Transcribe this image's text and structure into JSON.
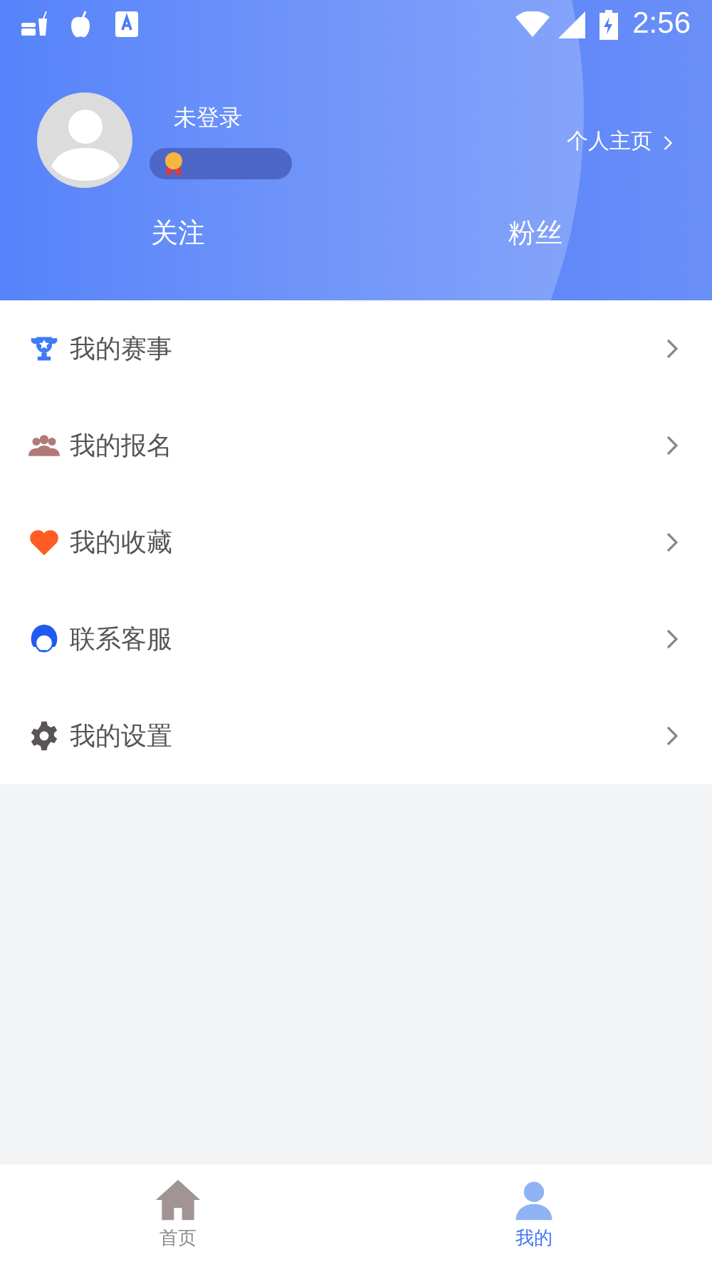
{
  "status_bar": {
    "time": "2:56"
  },
  "profile": {
    "name": "未登录",
    "homepage_link": "个人主页",
    "stats": [
      "关注",
      "粉丝"
    ]
  },
  "menu": [
    {
      "label": "我的赛事"
    },
    {
      "label": "我的报名"
    },
    {
      "label": "我的收藏"
    },
    {
      "label": "联系客服"
    },
    {
      "label": "我的设置"
    }
  ],
  "tab_bar": [
    {
      "label": "首页",
      "selected": false
    },
    {
      "label": "我的",
      "selected": true
    }
  ]
}
